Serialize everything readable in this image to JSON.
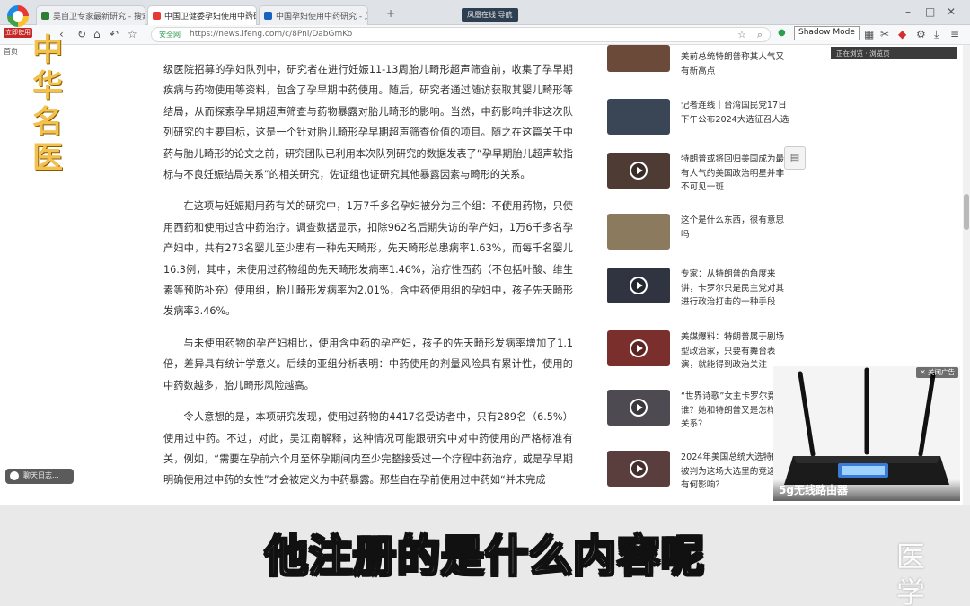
{
  "browser": {
    "tabs": [
      {
        "label": "吴自卫专家最新研究 - 搜索",
        "favicon_color": "#2e7d32"
      },
      {
        "label": "中国卫健委孕妇使用中药研究",
        "favicon_color": "#e53935"
      },
      {
        "label": "中国孕妇使用中药研究 - 凤凰",
        "favicon_color": "#1565c0"
      }
    ],
    "share_chip": "凤凰在线 导航",
    "url": "https://news.ifeng.com/c/8Pni/DabGmKo",
    "url_safe_label": "安全网",
    "shadow_mode": "Shadow Mode",
    "mini_panel": "正在浏览 · 浏览页"
  },
  "sidebar": {
    "logo_label": "立即使用",
    "home_label": "首页",
    "chat_label": "聊天日志..."
  },
  "watermark": {
    "vertical": "中华名医",
    "corner": "医学"
  },
  "article": {
    "paragraphs": [
      "级医院招募的孕妇队列中，研究者在进行妊娠11-13周胎儿畸形超声筛查前，收集了孕早期疾病与药物使用等资料，包含了孕早期中药使用。随后，研究者通过随访获取其婴儿畸形等结局，从而探索孕早期超声筛查与药物暴露对胎儿畸形的影响。当然，中药影响并非这次队列研究的主要目标，这是一个针对胎儿畸形孕早期超声筛查价值的项目。随之在这篇关于中药与胎儿畸形的论文之前，研究团队已利用本次队列研究的数据发表了“孕早期胎儿超声软指标与不良妊娠结局关系”的相关研究，佐证组也证研究其他暴露因素与畸形的关系。",
      "在这项与妊娠期用药有关的研究中，1万7千多名孕妇被分为三个组：不使用药物，只使用西药和使用过含中药治疗。调查数据显示，扣除962名后期失访的孕产妇，1万6千多名孕产妇中，共有273名婴儿至少患有一种先天畸形，先天畸形总患病率1.63%，而每千名婴儿16.3例，其中，未使用过药物组的先天畸形发病率1.46%，治疗性西药（不包括叶酸、维生素等预防补充）使用组，胎儿畸形发病率为2.01%，含中药使用组的孕妇中，孩子先天畸形发病率3.46%。",
      "与未使用药物的孕产妇相比，使用含中药的孕产妇，孩子的先天畸形发病率增加了1.1倍，差异具有统计学意义。后续的亚组分析表明：中药使用的剂量风险具有累计性，使用的中药数越多，胎儿畸形风险越高。",
      "令人意想的是，本项研究发现，使用过药物的4417名受访者中，只有289名（6.5%）使用过中药。不过，对此，吴江南解释，这种情况可能跟研究中对中药使用的严格标准有关，例如，“需要在孕前六个月至怀孕期间内至少完整接受过一个疗程中药治疗，或是孕早期明确使用过中药的女性”才会被定义为中药暴露。那些自在孕前使用过中药如“并未完成"
    ]
  },
  "news": [
    {
      "title": "美前总统特朗普称其人气又有新高点",
      "thumb": "#6b4a3a",
      "video": false
    },
    {
      "title": "记者连线｜台湾国民党17日下午公布2024大选征召人选",
      "thumb": "#3a4656",
      "video": false
    },
    {
      "title": "特朗普或将回归美国成为最有人气的美国政治明星并非不可见一斑",
      "thumb": "#4d3b34",
      "video": true
    },
    {
      "title": "这个是什么东西，很有意思吗",
      "thumb": "#8b7a5e",
      "video": false
    },
    {
      "title": "专家：从特朗普的角度来讲，卡罗尔只是民主党对其进行政治打击的一种手段",
      "thumb": "#2f3440",
      "video": true
    },
    {
      "title": "美媒爆料：特朗普属于剧场型政治家，只要有舞台表演，就能得到政治关注",
      "thumb": "#7b2f2c",
      "video": true
    },
    {
      "title": "“世界诗歌”女主卡罗尔竟是谁？她和特朗普又是怎样的关系？",
      "thumb": "#4e4a52",
      "video": true
    },
    {
      "title": "2024年美国总统大选特朗普被判为这场大选里的竞选者有何影响？",
      "thumb": "#5a3d3d",
      "video": true
    }
  ],
  "feedback_icon": "clipboard-icon",
  "ad": {
    "close_label": "关闭广告",
    "caption": "5g无线路由器"
  },
  "subtitle": "他注册的是什么内容呢"
}
